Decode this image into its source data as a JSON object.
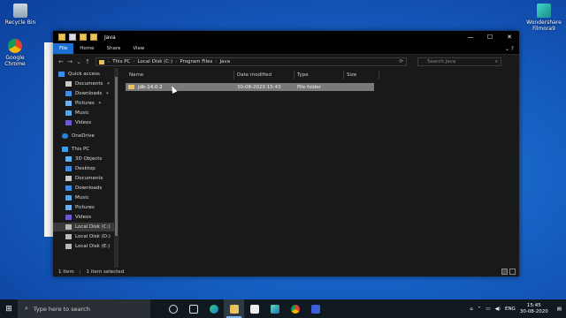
{
  "desktop": {
    "icons": [
      {
        "label": "Recycle Bin"
      },
      {
        "label": "Google Chrome"
      },
      {
        "label": "Wondershare Filmora9"
      }
    ]
  },
  "explorer": {
    "title": "Java",
    "window_buttons": {
      "minimize": "—",
      "maximize": "☐",
      "close": "✕"
    },
    "ribbon_tabs": [
      "File",
      "Home",
      "Share",
      "View"
    ],
    "help_glyph": "⌄ ?",
    "nav_glyphs": {
      "back": "←",
      "forward": "→",
      "recent": "⌄",
      "up": "↑"
    },
    "breadcrumb": [
      "This PC",
      "Local Disk (C:)",
      "Program Files",
      "Java"
    ],
    "search_placeholder": "Search Java",
    "nav_pane": [
      {
        "label": "Quick access"
      },
      {
        "label": "Documents",
        "pinned": true
      },
      {
        "label": "Downloads",
        "pinned": true
      },
      {
        "label": "Pictures",
        "pinned": true
      },
      {
        "label": "Music"
      },
      {
        "label": "Videos"
      },
      {
        "label": "OneDrive"
      },
      {
        "label": "This PC"
      },
      {
        "label": "3D Objects"
      },
      {
        "label": "Desktop"
      },
      {
        "label": "Documents"
      },
      {
        "label": "Downloads"
      },
      {
        "label": "Music"
      },
      {
        "label": "Pictures"
      },
      {
        "label": "Videos"
      },
      {
        "label": "Local Disk (C:)"
      },
      {
        "label": "Local Disk (D:)"
      },
      {
        "label": "Local Disk (E:)"
      }
    ],
    "columns": [
      "Name",
      "Date modified",
      "Type",
      "Size"
    ],
    "files": [
      {
        "name": "jdk-14.0.2",
        "date": "30-08-2020 15:43",
        "type": "File folder",
        "size": ""
      }
    ],
    "status": {
      "count": "1 item",
      "selected": "1 item selected"
    }
  },
  "taskbar": {
    "search_placeholder": "Type here to search",
    "tray": {
      "lang": "ENG",
      "time": "15:45",
      "date": "30-08-2020"
    }
  },
  "colors": {
    "accent": "#1a6fd1",
    "folder": "#e8c25a",
    "explorer_bg": "#191919"
  }
}
